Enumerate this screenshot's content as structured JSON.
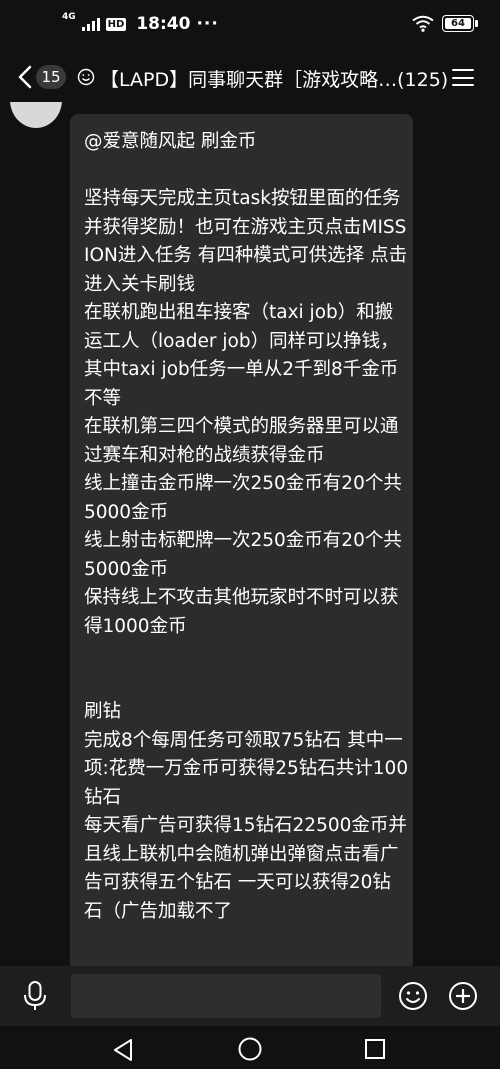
{
  "status_bar": {
    "network": "4G",
    "hd": "HD",
    "time": "18:40",
    "dots": "···",
    "battery": "64"
  },
  "header": {
    "unread_count": "15",
    "title": "【LAPD】同事聊天群［游戏攻略…(125)"
  },
  "message": {
    "text": "@爱意随风起 刷金币\n\n坚持每天完成主页task按钮里面的任务并获得奖励！也可在游戏主页点击MISSION进入任务 有四种模式可供选择 点击进入关卡刷钱\n在联机跑出租车接客（taxi job）和搬运工人（loader job）同样可以挣钱，其中taxi job任务一单从2千到8千金币不等\n在联机第三四个模式的服务器里可以通过赛车和对枪的战绩获得金币\n线上撞击金币牌一次250金币有20个共5000金币\n线上射击标靶牌一次250金币有20个共5000金币\n保持线上不攻击其他玩家时不时可以获得1000金币\n\n\n刷钻\n完成8个每周任务可领取75钻石 其中一项:花费一万金币可获得25钻石共计100钻石\n每天看广告可获得15钻石22500金币并且线上联机中会随机弹出弹窗点击看广告可获得五个钻石 一天可以获得20钻石（广告加载不了"
  },
  "input": {
    "placeholder": ""
  },
  "colors": {
    "background": "#111111",
    "bubble": "#2c2c2e",
    "input_bar": "#1e1e1e",
    "text": "#ffffff"
  },
  "icons": [
    "back-chevron-icon",
    "smiley-icon",
    "menu-icon",
    "voice-icon",
    "emoji-icon",
    "plus-icon",
    "nav-back-icon",
    "nav-home-icon",
    "nav-recent-icon",
    "wifi-icon",
    "signal-icon"
  ]
}
